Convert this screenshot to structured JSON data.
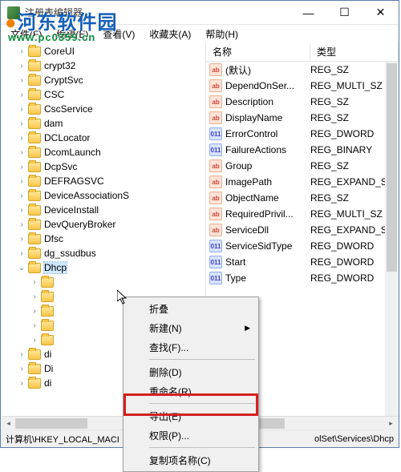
{
  "window": {
    "title": "注册表编辑器"
  },
  "menubar": {
    "file": "文件(F)",
    "edit": "编辑(E)",
    "view": "查看(V)",
    "favorites": "收藏夹(A)",
    "help": "帮助(H)"
  },
  "tree": {
    "indent_base": 80,
    "items": [
      {
        "label": "CoreUI",
        "indent": 100,
        "expander": "›"
      },
      {
        "label": "crypt32",
        "indent": 100,
        "expander": "›"
      },
      {
        "label": "CryptSvc",
        "indent": 100,
        "expander": "›"
      },
      {
        "label": "CSC",
        "indent": 100,
        "expander": "›"
      },
      {
        "label": "CscService",
        "indent": 100,
        "expander": "›"
      },
      {
        "label": "dam",
        "indent": 100,
        "expander": "›"
      },
      {
        "label": "DCLocator",
        "indent": 100,
        "expander": "›"
      },
      {
        "label": "DcomLaunch",
        "indent": 100,
        "expander": "›"
      },
      {
        "label": "DcpSvc",
        "indent": 100,
        "expander": "›"
      },
      {
        "label": "DEFRAGSVC",
        "indent": 100,
        "expander": "›"
      },
      {
        "label": "DeviceAssociationS",
        "indent": 100,
        "expander": "›"
      },
      {
        "label": "DeviceInstall",
        "indent": 100,
        "expander": "›"
      },
      {
        "label": "DevQueryBroker",
        "indent": 100,
        "expander": "›"
      },
      {
        "label": "Dfsc",
        "indent": 100,
        "expander": "›"
      },
      {
        "label": "dg_ssudbus",
        "indent": 100,
        "expander": "›"
      },
      {
        "label": "Dhcp",
        "indent": 100,
        "expander": "⌄",
        "selected": true
      },
      {
        "label": "",
        "indent": 116,
        "expander": "›"
      },
      {
        "label": "",
        "indent": 116,
        "expander": "›"
      },
      {
        "label": "",
        "indent": 116,
        "expander": "›"
      },
      {
        "label": "",
        "indent": 116,
        "expander": "›"
      },
      {
        "label": "",
        "indent": 116,
        "expander": "›"
      },
      {
        "label": "di",
        "indent": 100,
        "expander": "›"
      },
      {
        "label": "Di",
        "indent": 100,
        "expander": "›"
      },
      {
        "label": "di",
        "indent": 100,
        "expander": "›"
      }
    ]
  },
  "list": {
    "header": {
      "name": "名称",
      "type": "类型"
    },
    "rows": [
      {
        "name": "(默认)",
        "type": "REG_SZ",
        "iconType": "sz",
        "iconText": "ab"
      },
      {
        "name": "DependOnSer...",
        "type": "REG_MULTI_SZ",
        "iconType": "sz",
        "iconText": "ab"
      },
      {
        "name": "Description",
        "type": "REG_SZ",
        "iconType": "sz",
        "iconText": "ab"
      },
      {
        "name": "DisplayName",
        "type": "REG_SZ",
        "iconType": "sz",
        "iconText": "ab"
      },
      {
        "name": "ErrorControl",
        "type": "REG_DWORD",
        "iconType": "bin",
        "iconText": "011"
      },
      {
        "name": "FailureActions",
        "type": "REG_BINARY",
        "iconType": "bin",
        "iconText": "011"
      },
      {
        "name": "Group",
        "type": "REG_SZ",
        "iconType": "sz",
        "iconText": "ab"
      },
      {
        "name": "ImagePath",
        "type": "REG_EXPAND_SZ",
        "iconType": "sz",
        "iconText": "ab"
      },
      {
        "name": "ObjectName",
        "type": "REG_SZ",
        "iconType": "sz",
        "iconText": "ab"
      },
      {
        "name": "RequiredPrivil...",
        "type": "REG_MULTI_SZ",
        "iconType": "sz",
        "iconText": "ab"
      },
      {
        "name": "ServiceDll",
        "type": "REG_EXPAND_SZ",
        "iconType": "sz",
        "iconText": "ab"
      },
      {
        "name": "ServiceSidType",
        "type": "REG_DWORD",
        "iconType": "bin",
        "iconText": "011"
      },
      {
        "name": "Start",
        "type": "REG_DWORD",
        "iconType": "bin",
        "iconText": "011"
      },
      {
        "name": "Type",
        "type": "REG_DWORD",
        "iconType": "bin",
        "iconText": "011"
      }
    ]
  },
  "context_menu": {
    "items": [
      {
        "label": "折叠",
        "sep": false,
        "arrow": false
      },
      {
        "label": "新建(N)",
        "sep": false,
        "arrow": true
      },
      {
        "label": "查找(F)...",
        "sep": false,
        "arrow": false
      },
      {
        "sep": true
      },
      {
        "label": "删除(D)",
        "sep": false,
        "arrow": false
      },
      {
        "label": "重命名(R)",
        "sep": false,
        "arrow": false
      },
      {
        "sep": true
      },
      {
        "label": "导出(E)",
        "sep": false,
        "arrow": false
      },
      {
        "label": "权限(P)...",
        "sep": false,
        "arrow": false
      },
      {
        "sep": true
      },
      {
        "label": "复制项名称(C)",
        "sep": false,
        "arrow": false
      }
    ]
  },
  "statusbar": {
    "path_left": "计算机\\HKEY_LOCAL_MACI",
    "path_right": "olSet\\Services\\Dhcp"
  },
  "watermark": {
    "line1_a": "河东软件园",
    "line2": "www.pc0359.cn"
  }
}
